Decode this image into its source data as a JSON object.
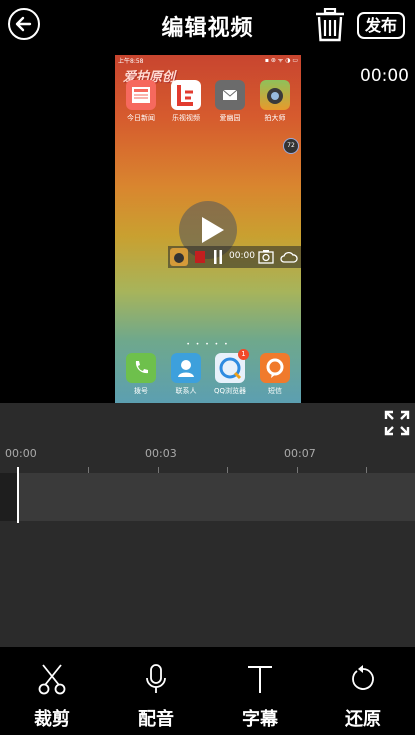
{
  "header": {
    "title": "编辑视频",
    "publish_label": "发布"
  },
  "preview": {
    "time": "00:00",
    "phone": {
      "status_left": "上午8:58",
      "status_right": "▪ ⊛ ᯤ ◑ ▭",
      "watermark": "爱拍原创",
      "top_apps": [
        {
          "label": "今日新闻",
          "color": "#f6695e",
          "icon": "news-icon"
        },
        {
          "label": "乐视视频",
          "color": "#e23b2f",
          "icon": "letv-icon"
        },
        {
          "label": "爱幽园",
          "color": "#6b6b6b",
          "icon": "mail-icon"
        },
        {
          "label": "拍大师",
          "color": "#5a8b3c",
          "icon": "camera-master-icon"
        }
      ],
      "badge": "72",
      "pager": "• • • • •",
      "record_time": "00:00",
      "dock_apps": [
        {
          "label": "拨号",
          "color": "#6ec04c",
          "icon": "phone-icon"
        },
        {
          "label": "联系人",
          "color": "#3da0dc",
          "icon": "contacts-icon"
        },
        {
          "label": "QQ浏览器",
          "color": "#e8f1fb",
          "icon": "qq-browser-icon",
          "badge": "1"
        },
        {
          "label": "短信",
          "color": "#f07a2c",
          "icon": "sms-icon"
        }
      ]
    }
  },
  "timeline": {
    "ticks": [
      "00:00",
      "00:03",
      "00:07"
    ]
  },
  "toolbar": {
    "items": [
      {
        "label": "裁剪",
        "icon": "scissors-icon"
      },
      {
        "label": "配音",
        "icon": "microphone-icon"
      },
      {
        "label": "字幕",
        "icon": "text-icon"
      },
      {
        "label": "还原",
        "icon": "restore-icon"
      }
    ]
  }
}
